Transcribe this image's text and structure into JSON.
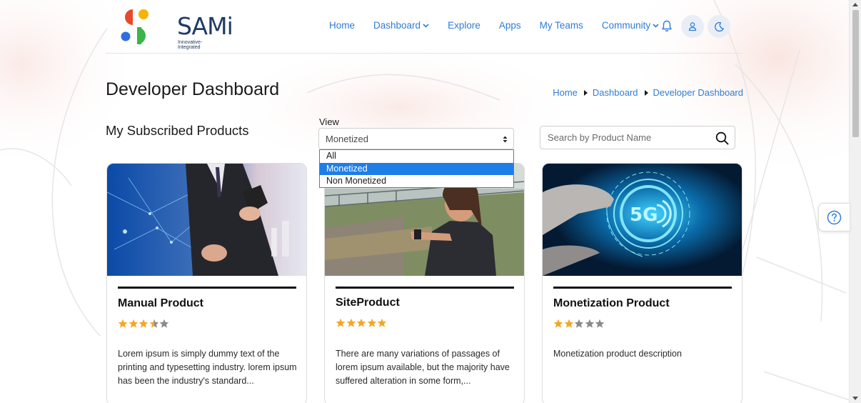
{
  "brand": {
    "name": "SAMi",
    "tagline": "Innovative-Integrated"
  },
  "nav": {
    "items": [
      {
        "label": "Home",
        "dropdown": false
      },
      {
        "label": "Dashboard",
        "dropdown": true
      },
      {
        "label": "Explore",
        "dropdown": false
      },
      {
        "label": "Apps",
        "dropdown": false
      },
      {
        "label": "My Teams",
        "dropdown": false
      },
      {
        "label": "Community",
        "dropdown": true
      }
    ],
    "icons": [
      "bell-icon",
      "user-icon",
      "moon-icon"
    ]
  },
  "page": {
    "title": "Developer Dashboard"
  },
  "breadcrumb": [
    "Home",
    "Dashboard",
    "Developer Dashboard"
  ],
  "section": {
    "title": "My Subscribed Products"
  },
  "view": {
    "label": "View",
    "selected": "Monetized",
    "options": [
      "All",
      "Monetized",
      "Non Monetized"
    ]
  },
  "search": {
    "placeholder": "Search by Product Name"
  },
  "products": [
    {
      "title": "Manual Product",
      "rating": 3.5,
      "description": "Lorem ipsum is simply dummy text of the printing and typesetting industry. lorem ipsum has been the industry's standard..."
    },
    {
      "title": "SiteProduct",
      "rating": 5,
      "description": "There are many variations of passages of lorem ipsum available, but the majority have suffered alteration in some form,..."
    },
    {
      "title": "Monetization Product",
      "rating": 2,
      "description": "Monetization product description"
    }
  ],
  "colors": {
    "accent": "#2e7dd7",
    "star_filled": "#f5a623",
    "star_empty": "#8a8a8a",
    "selected_option": "#1e7ee8"
  }
}
